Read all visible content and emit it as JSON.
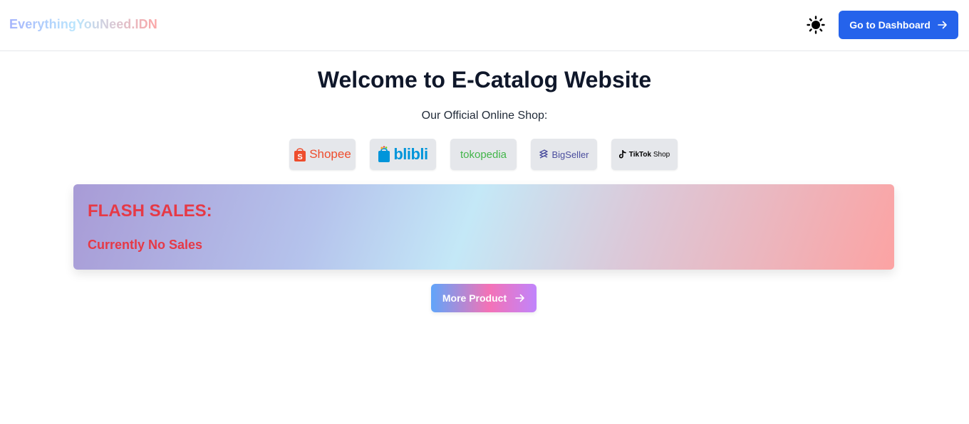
{
  "navbar": {
    "brand": "EverythingYouNeed.IDN",
    "theme_icon": "sun-icon",
    "dashboard_button": "Go to Dashboard",
    "dashboard_icon": "arrow-right-icon"
  },
  "hero": {
    "title": "Welcome to E-Catalog Website",
    "subtitle": "Our Official Online Shop:"
  },
  "shops": [
    {
      "label": "Shopee",
      "icon": "shopee-bag-icon",
      "color": "#ee4d2d"
    },
    {
      "label": "blibli",
      "icon": "blibli-bag-icon",
      "color": "#0095da"
    },
    {
      "label": "tokopedia",
      "color": "#42b549"
    },
    {
      "label": "BigSeller",
      "icon": "bigseller-icon",
      "color": "#4b4e9e"
    },
    {
      "label": "TikTok",
      "sublabel": "Shop",
      "icon": "tiktok-icon",
      "color": "#000000"
    }
  ],
  "flash_sales": {
    "title": "FLASH SALES:",
    "status": "Currently No Sales",
    "text_color": "#e63946"
  },
  "more_button": {
    "label": "More Product",
    "icon": "arrow-right-icon"
  },
  "colors": {
    "primary": "#2563eb",
    "heading": "#0f172a"
  }
}
